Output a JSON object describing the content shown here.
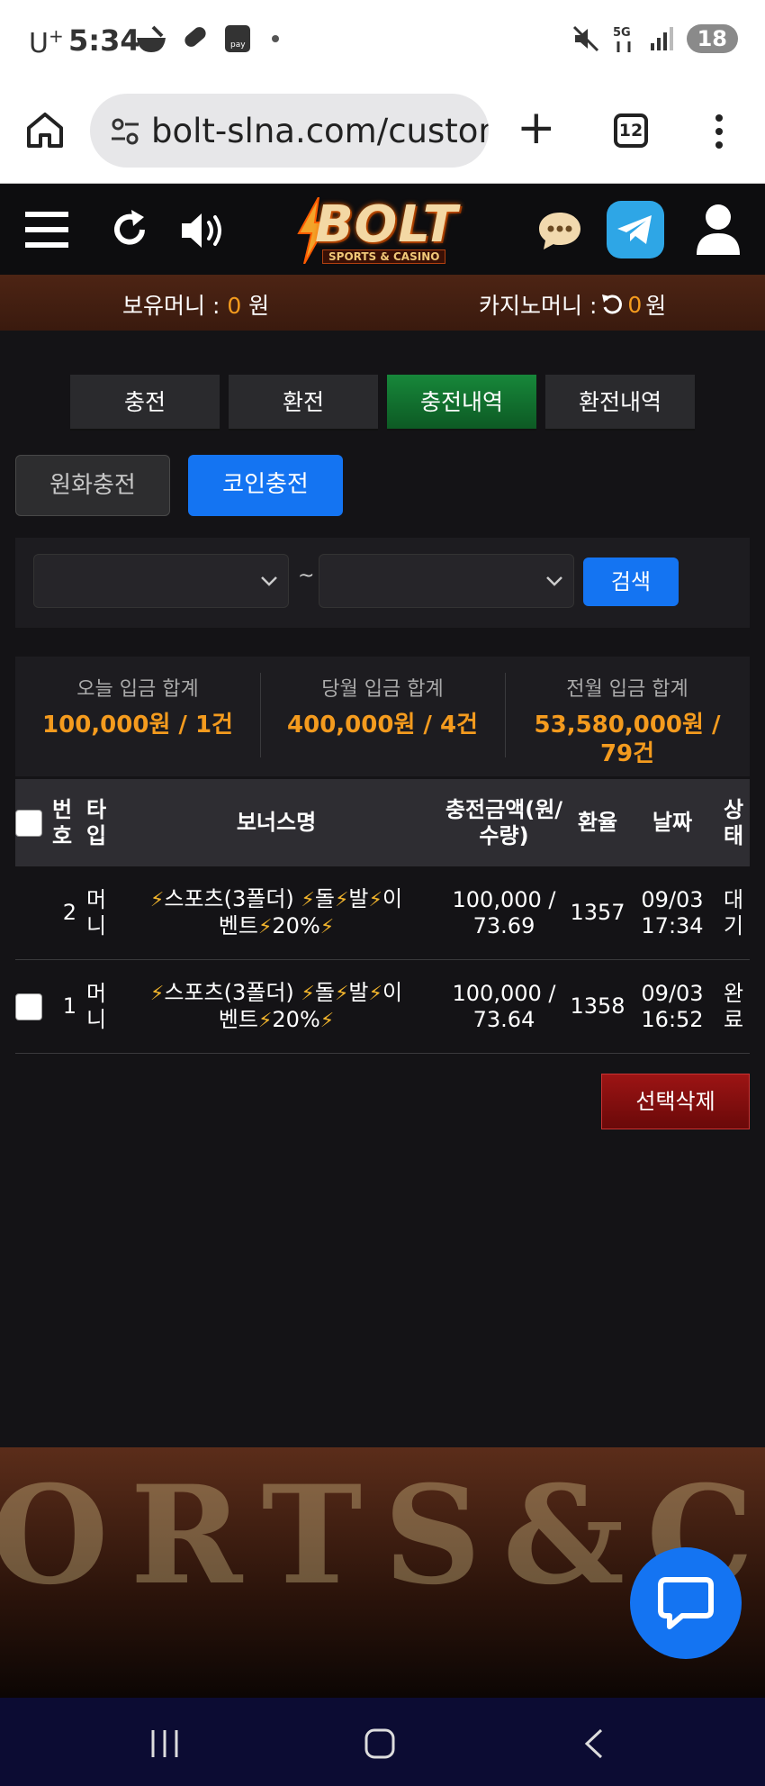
{
  "status_bar": {
    "carrier": "U",
    "carrier_sup": "+",
    "time": "5:34",
    "battery": "18"
  },
  "browser": {
    "url": "bolt-slna.com/custom",
    "tab_count": "12"
  },
  "header": {
    "logo_text": "BOLT",
    "logo_subtitle": "SPORTS & CASINO"
  },
  "balance": {
    "holding_label": "보유머니 : ",
    "holding_value": "0",
    "holding_unit": " 원",
    "casino_label": "카지노머니 : ",
    "casino_value": "0",
    "casino_unit": " 원"
  },
  "tabs": [
    {
      "label": "충전",
      "active": false
    },
    {
      "label": "환전",
      "active": false
    },
    {
      "label": "충전내역",
      "active": true
    },
    {
      "label": "환전내역",
      "active": false
    }
  ],
  "subtabs": [
    {
      "label": "원화충전",
      "active": false
    },
    {
      "label": "코인충전",
      "active": true
    }
  ],
  "filter": {
    "start_value": "",
    "end_value": "",
    "separator": "~",
    "search_label": "검색"
  },
  "summary": [
    {
      "label": "오늘 입금 합계",
      "value": "100,000원 / 1건"
    },
    {
      "label": "당월 입금 합계",
      "value": "400,000원 / 4건"
    },
    {
      "label": "전월 입금 합계",
      "value": "53,580,000원 / 79건"
    }
  ],
  "table": {
    "headers": {
      "no": "번호",
      "type": "타입",
      "bonus": "보너스명",
      "amount": "충전금액(원/수량)",
      "rate": "환율",
      "date": "날짜",
      "status": "상태"
    },
    "rows": [
      {
        "has_checkbox": false,
        "no": "2",
        "type": "머니",
        "bonus_line1": "스포츠(3폴더)",
        "bonus_part2": "돌",
        "bonus_part3": "발",
        "bonus_part4": "이",
        "bonus_line2": "벤트",
        "bonus_part5": "20%",
        "amount_line1": "100,000 /",
        "amount_line2": "73.69",
        "rate": "1357",
        "date_line1": "09/03",
        "date_line2": "17:34",
        "status": "대기"
      },
      {
        "has_checkbox": true,
        "no": "1",
        "type": "머니",
        "bonus_line1": "스포츠(3폴더)",
        "bonus_part2": "돌",
        "bonus_part3": "발",
        "bonus_part4": "이",
        "bonus_line2": "벤트",
        "bonus_part5": "20%",
        "amount_line1": "100,000 /",
        "amount_line2": "73.64",
        "rate": "1358",
        "date_line1": "09/03",
        "date_line2": "16:52",
        "status": "완료"
      }
    ]
  },
  "delete_button": "선택삭제",
  "footer_banner_text": "ORTS&C",
  "colors": {
    "accent_blue": "#1474f2",
    "accent_orange": "#f49b1e",
    "tab_active_green": "#17873a",
    "delete_red": "#9c1414"
  }
}
